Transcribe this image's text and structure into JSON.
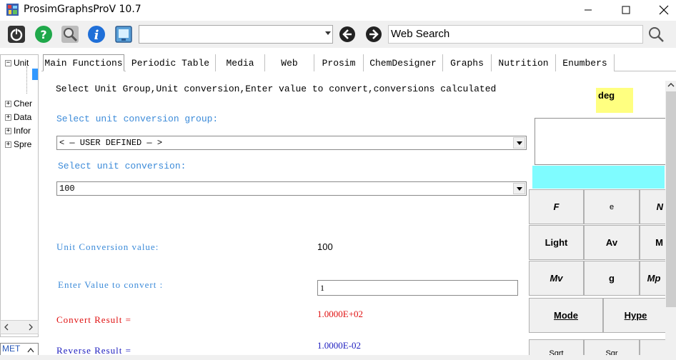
{
  "window": {
    "title": "ProsimGraphsProV 10.7"
  },
  "toolbar": {
    "combo_value": "",
    "web_search_value": "Web Search",
    "icons": [
      "power-icon",
      "help-icon",
      "search-icon",
      "info-icon",
      "screen-icon",
      "back-icon",
      "forward-icon",
      "magnifier-icon"
    ]
  },
  "tree": {
    "items": [
      {
        "label": "Unit",
        "expander": "⊟"
      },
      {
        "label": "Cher",
        "expander": "⊞"
      },
      {
        "label": "Data",
        "expander": "⊞"
      },
      {
        "label": "Infor",
        "expander": "⊞"
      },
      {
        "label": "Spre",
        "expander": "⊞"
      }
    ],
    "bottom_field": "MET"
  },
  "tabs": [
    {
      "label": "Main Functions",
      "active": true
    },
    {
      "label": "Periodic Table"
    },
    {
      "label": "Media"
    },
    {
      "label": "Web"
    },
    {
      "label": "Prosim"
    },
    {
      "label": "ChemDesigner"
    },
    {
      "label": "Graphs"
    },
    {
      "label": "Nutrition"
    },
    {
      "label": "Enumbers"
    }
  ],
  "main": {
    "description": "Select Unit Group,Unit conversion,Enter value to convert,conversions calculated",
    "group_label": "Select unit conversion group:",
    "group_value": "< — USER DEFINED — >",
    "conversion_label": "Select unit conversion:",
    "conversion_value": "100",
    "conversion_value_label": "Unit Conversion value:",
    "enter_label": "Enter Value to convert :",
    "enter_value": "1",
    "convert_result_label": "Convert Result =",
    "convert_result": "1.0000E+02",
    "reverse_result_label": "Reverse Result =",
    "reverse_result": "1.0000E-02"
  },
  "calculator": {
    "mode": "deg",
    "keys": {
      "F": "F",
      "e": "e",
      "Light": "Light",
      "Av": "Av",
      "Mv": "Mv",
      "g": "g",
      "Mp": "Mp",
      "Mode": "Mode",
      "Hype": "Hype",
      "Sqrt": "Sqrt",
      "Sqr": "Sqr"
    }
  },
  "colors": {
    "label_blue": "#3c8bd9",
    "result_red": "#e01010",
    "result_blue": "#2020c0",
    "deg_yellow": "#ffff80",
    "display_cyan": "#7ffcff"
  }
}
